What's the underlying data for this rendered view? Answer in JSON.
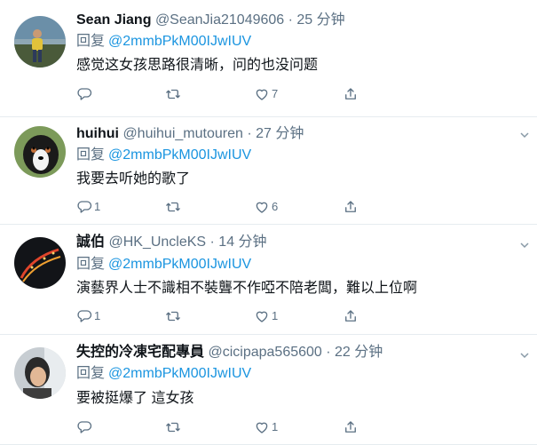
{
  "tweets": [
    {
      "name": "Sean Jiang",
      "handle_time": "@SeanJia21049606 · 25 分钟",
      "reply_label": "回复",
      "reply_to": "@2mmbPkM00IJwIUV",
      "text": "感觉这女孩思路很清晰，问的也没问题",
      "reply_count": "",
      "retweet_count": "",
      "like_count": "7",
      "avatar_icon": "person-standing-photo"
    },
    {
      "name": "huihui",
      "handle_time": "@huihui_mutouren · 27 分钟",
      "reply_label": "回复",
      "reply_to": "@2mmbPkM00IJwIUV",
      "text": "我要去听她的歌了",
      "reply_count": "1",
      "retweet_count": "",
      "like_count": "6",
      "avatar_icon": "dog-photo"
    },
    {
      "name": "誠伯",
      "handle_time": "@HK_UncleKS · 14 分钟",
      "reply_label": "回复",
      "reply_to": "@2mmbPkM00IJwIUV",
      "text": "演藝界人士不識相不裝聾不作啞不陪老闆，難以上位啊",
      "reply_count": "1",
      "retweet_count": "",
      "like_count": "1",
      "avatar_icon": "night-city-photo"
    },
    {
      "name": "失控的冷凍宅配專員",
      "handle_time": "@cicipapa565600 · 22 分钟",
      "reply_label": "回复",
      "reply_to": "@2mmbPkM00IJwIUV",
      "text": "要被挺爆了 這女孩",
      "reply_count": "",
      "retweet_count": "",
      "like_count": "1",
      "avatar_icon": "person-portrait-photo"
    }
  ],
  "colors": {
    "name": "#0f1419",
    "meta": "#5b7083",
    "mention": "#1b95e0",
    "divider": "#e6ecf0"
  }
}
